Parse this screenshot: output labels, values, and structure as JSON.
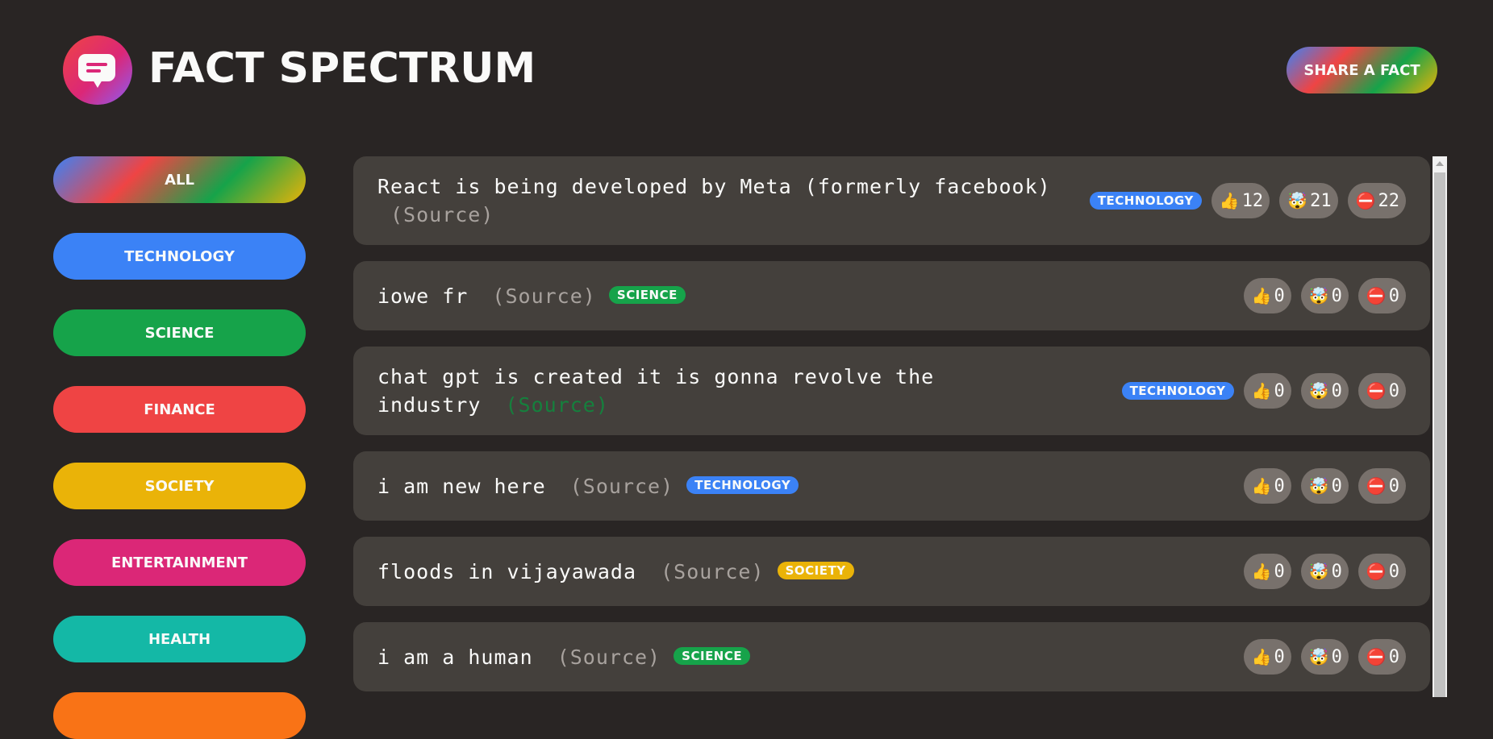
{
  "header": {
    "title": "Fact Spectrum",
    "share_label": "Share a fact"
  },
  "categories": [
    {
      "label": "All",
      "color": "gradient"
    },
    {
      "label": "Technology",
      "color": "#3b82f6"
    },
    {
      "label": "Science",
      "color": "#16a34a"
    },
    {
      "label": "Finance",
      "color": "#ef4444"
    },
    {
      "label": "Society",
      "color": "#eab308"
    },
    {
      "label": "Entertainment",
      "color": "#db2777"
    },
    {
      "label": "Health",
      "color": "#14b8a6"
    }
  ],
  "facts": [
    {
      "text": "React is being developed by Meta (formerly facebook)",
      "source": "(Source)",
      "category": "Technology",
      "interesting": "12",
      "mindblowing": "21",
      "false": "22"
    },
    {
      "text": "iowe fr",
      "source": "(Source)",
      "category": "Science",
      "interesting": "0",
      "mindblowing": "0",
      "false": "0"
    },
    {
      "text": "chat gpt is created it is gonna revolve the industry",
      "source": "(Source)",
      "category": "Technology",
      "interesting": "0",
      "mindblowing": "0",
      "false": "0"
    },
    {
      "text": "i am new here",
      "source": "(Source)",
      "category": "Technology",
      "interesting": "0",
      "mindblowing": "0",
      "false": "0"
    },
    {
      "text": "floods in vijayawada",
      "source": "(Source)",
      "category": "Society",
      "interesting": "0",
      "mindblowing": "0",
      "false": "0"
    },
    {
      "text": "i am a human",
      "source": "(Source)",
      "category": "Science",
      "interesting": "0",
      "mindblowing": "0",
      "false": "0"
    }
  ],
  "vote_icons": {
    "interesting": "thumbs-up-icon",
    "mindblowing": "exploding-head-icon",
    "false": "no-entry-icon"
  },
  "colors": {
    "background": "#292524",
    "card": "#44403c",
    "vote_button": "#78716c",
    "technology": "#3b82f6",
    "science": "#16a34a",
    "finance": "#ef4444",
    "society": "#eab308",
    "entertainment": "#db2777",
    "health": "#14b8a6"
  }
}
